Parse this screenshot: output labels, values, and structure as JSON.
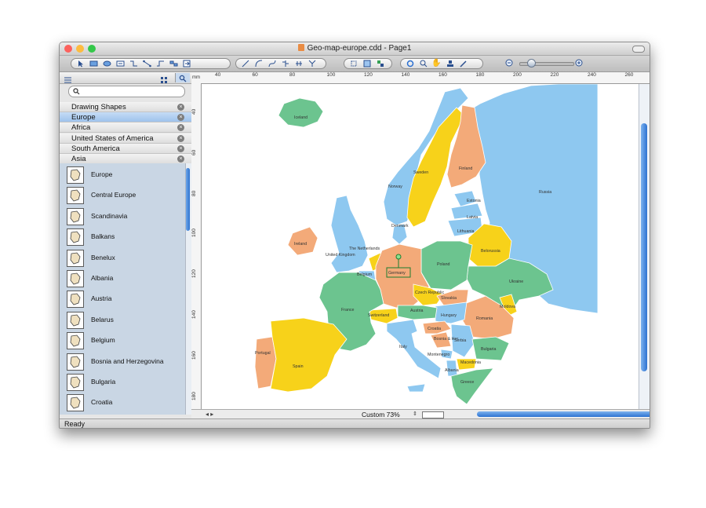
{
  "window": {
    "title": "Geo-map-europe.cdd - Page1",
    "traffic_colors": {
      "close": "#fc615d",
      "minimize": "#fdbc40",
      "zoom": "#34c84a"
    }
  },
  "toolbar": {
    "icons": [
      "pointer-icon",
      "rectangle-icon",
      "ellipse-icon",
      "text-box-icon",
      "connector-icon",
      "smart-connector-icon",
      "routing-icon",
      "chain-icon",
      "insert-icon",
      "line-icon",
      "arc-icon",
      "bezier-icon",
      "tree-icon",
      "spatial-icon",
      "snap-icon",
      "group-icon",
      "layout-icon",
      "refresh-icon",
      "zoom-icon",
      "hand-icon",
      "stamp-icon",
      "eyedropper-icon",
      "zoom-out-icon",
      "zoom-in-icon"
    ]
  },
  "sidebar": {
    "search_placeholder": "",
    "libraries": [
      {
        "label": "Drawing Shapes",
        "selected": false
      },
      {
        "label": "Europe",
        "selected": true
      },
      {
        "label": "Africa",
        "selected": false
      },
      {
        "label": "United States of America",
        "selected": false
      },
      {
        "label": "South America",
        "selected": false
      },
      {
        "label": "Asia",
        "selected": false
      }
    ],
    "shapes": [
      "Europe",
      "Central Europe",
      "Scandinavia",
      "Balkans",
      "Benelux",
      "Albania",
      "Austria",
      "Belarus",
      "Belgium",
      "Bosnia and Herzegovina",
      "Bulgaria",
      "Croatia"
    ]
  },
  "ruler": {
    "unit": "mm",
    "h_ticks": [
      "40",
      "60",
      "80",
      "100",
      "120",
      "140",
      "160",
      "180",
      "200",
      "220",
      "240",
      "260"
    ],
    "v_ticks": [
      "40",
      "60",
      "80",
      "100",
      "120",
      "140",
      "160",
      "180"
    ]
  },
  "map": {
    "colors": {
      "sea": "#ffffff",
      "green": "#6cc48f",
      "blue": "#8ec8f0",
      "orange": "#f3aa79",
      "yellow": "#f7d21a",
      "border": "#ffffff"
    },
    "labels": [
      "Iceland",
      "Norway",
      "Sweden",
      "Finland",
      "Russia",
      "Estonia",
      "Latvia",
      "Lithuania",
      "Denmark",
      "Ireland",
      "United Kingdom",
      "The Netherlands",
      "Belgium",
      "Germany",
      "Poland",
      "Belorussia",
      "Ukraine",
      "Czech Republic",
      "Slovakia",
      "Moldova",
      "Hungary",
      "Romania",
      "France",
      "Switzerland",
      "Austria",
      "Croatia",
      "Bosnia & Her.",
      "Serbia",
      "Italy",
      "Montenegro",
      "Bulgaria",
      "Macedonia",
      "Albania",
      "Greece",
      "Portugal",
      "Spain"
    ],
    "selected_country": "Germany"
  },
  "bottom_bar": {
    "zoom": "Custom 73%"
  },
  "status": {
    "text": "Ready"
  }
}
